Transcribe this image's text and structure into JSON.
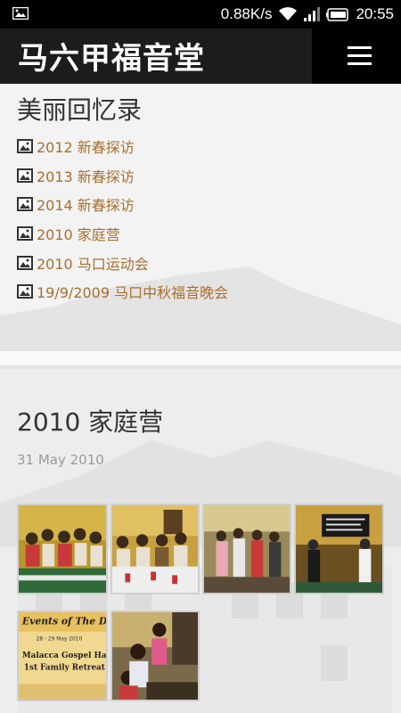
{
  "status_bar": {
    "network_speed": "0.88K/s",
    "time": "20:55",
    "icons": [
      "gallery-notification-icon",
      "wifi-icon",
      "signal-icon",
      "battery-icon"
    ]
  },
  "header": {
    "site_title": "马六甲福音堂",
    "menu_icon": "hamburger-menu-icon"
  },
  "memories": {
    "title": "美丽回忆录",
    "albums": [
      {
        "label": "2012 新春探访",
        "icon": "image-icon"
      },
      {
        "label": "2013 新春探访",
        "icon": "image-icon"
      },
      {
        "label": "2014 新春探访",
        "icon": "image-icon"
      },
      {
        "label": "2010 家庭营",
        "icon": "image-icon"
      },
      {
        "label": "2010 马口运动会",
        "icon": "image-icon"
      },
      {
        "label": "19/9/2009 马口中秋福音晚会",
        "icon": "image-icon"
      }
    ]
  },
  "post": {
    "title": "2010 家庭营",
    "date": "31 May 2010",
    "thumbnails": [
      {
        "name": "photo-group-dinner"
      },
      {
        "name": "photo-elders-table"
      },
      {
        "name": "photo-group-standing"
      },
      {
        "name": "photo-banner-speakers"
      },
      {
        "name": "photo-events-poster",
        "text_line1": "Events of The Day",
        "text_line2": "28 - 29 May 2010",
        "text_line3": "Malacca Gospel Hall",
        "text_line4": "1st Family Retreat"
      },
      {
        "name": "photo-children"
      }
    ]
  },
  "colors": {
    "link": "#a86f2d",
    "header_bg": "#000000",
    "title_box_bg": "#1c1c1c"
  }
}
